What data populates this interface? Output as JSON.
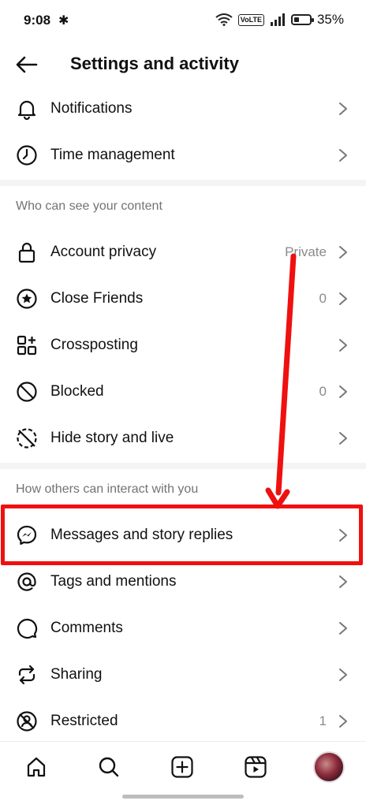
{
  "status_bar": {
    "time": "9:08",
    "bluetooth": "✱",
    "volte": "VoLTE",
    "battery": "35%",
    "battery_level": 0.35
  },
  "header": {
    "title": "Settings and activity"
  },
  "top_items": [
    {
      "label": "Notifications",
      "icon": "bell-icon"
    },
    {
      "label": "Time management",
      "icon": "clock-icon"
    }
  ],
  "sections": {
    "visibility_title": "Who can see your content",
    "interaction_title": "How others can interact with you"
  },
  "visibility_items": [
    {
      "label": "Account privacy",
      "value": "Private",
      "icon": "lock-icon"
    },
    {
      "label": "Close Friends",
      "value": "0",
      "icon": "star-circle-icon"
    },
    {
      "label": "Crossposting",
      "value": "",
      "icon": "grid-plus-icon"
    },
    {
      "label": "Blocked",
      "value": "0",
      "icon": "blocked-icon"
    },
    {
      "label": "Hide story and live",
      "value": "",
      "icon": "hide-story-icon"
    }
  ],
  "interaction_items": [
    {
      "label": "Messages and story replies",
      "value": "",
      "icon": "messenger-icon"
    },
    {
      "label": "Tags and mentions",
      "value": "",
      "icon": "at-icon"
    },
    {
      "label": "Comments",
      "value": "",
      "icon": "comment-icon"
    },
    {
      "label": "Sharing",
      "value": "",
      "icon": "share-arrows-icon"
    },
    {
      "label": "Restricted",
      "value": "1",
      "icon": "restricted-icon"
    }
  ],
  "annotation_color": "#ef1010",
  "bottom_nav": [
    "home-icon",
    "search-icon",
    "create-icon",
    "reels-icon",
    "profile-avatar"
  ]
}
